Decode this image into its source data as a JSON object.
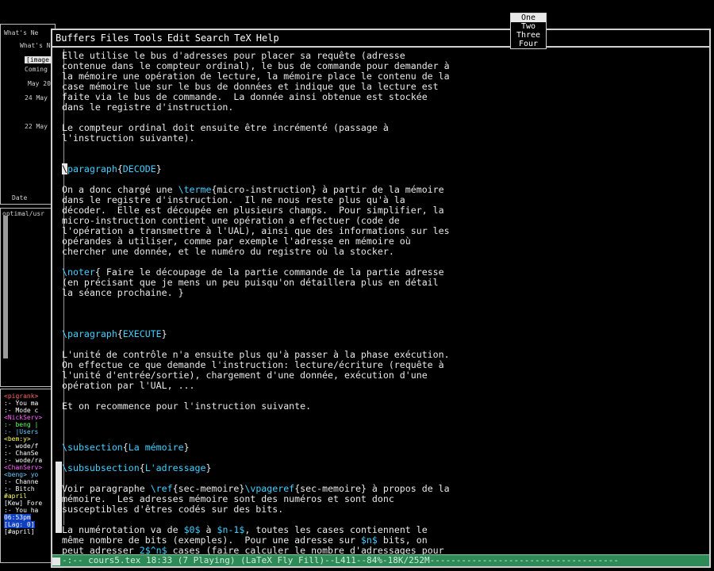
{
  "menubar": {
    "items": [
      "Buffers",
      "Files",
      "Tools",
      "Edit",
      "Search",
      "TeX",
      "Help"
    ]
  },
  "popup": {
    "items": [
      "One",
      "Two",
      "Three",
      "Four"
    ],
    "active_index": 0
  },
  "left_top": {
    "lines": [
      "What's Ne",
      "What's N",
      "[image",
      "Coming",
      "May 20",
      "24 May",
      "22 May",
      "Date"
    ]
  },
  "left_mid": {
    "lines": [
      "optimal/usr"
    ]
  },
  "left_bot": {
    "lines": [
      "<pigrank>",
      ":- You ma",
      ":- Mode c",
      "<NickServ>",
      ":- beng |",
      ":- |Users",
      "<bem:y>",
      ":- wode/f",
      ":- ChanSe",
      ":- wode/ra",
      "<ChanServ>",
      "<beng> yo",
      ":- Channe",
      ":- Bitch",
      "#april",
      "[Kew] Fore",
      ":- You ha",
      "06:53pm",
      "[Lag: 0]",
      "[#april]"
    ],
    "colors": [
      "#ff6666",
      "#ffffff",
      "#ffffff",
      "#ff66ff",
      "#66ff66",
      "#66ccff",
      "#ffff66",
      "#ffffff",
      "#ffffff",
      "#ffffff",
      "#ff66ff",
      "#66ccff",
      "#ffffff",
      "#ffffff",
      "#ffff66",
      "#ffffff",
      "#ffffff",
      "#66ccff",
      "#66ccff",
      "#ffffff"
    ]
  },
  "editor": {
    "lines": [
      [
        {
          "t": "Elle utilise le bus d'adresses pour placer sa requête (adresse"
        }
      ],
      [
        {
          "t": "contenue dans le compteur ordinal), le bus de commande pour demander à"
        }
      ],
      [
        {
          "t": "la mémoire une opération de lecture, la mémoire place le contenu de la"
        }
      ],
      [
        {
          "t": "case mémoire lue sur le bus de données et indique que la lecture est"
        }
      ],
      [
        {
          "t": "faite via le bus de commande.  La donnée ainsi obtenue est stockée"
        }
      ],
      [
        {
          "t": "dans le registre d'instruction."
        }
      ],
      [
        {
          "t": ""
        }
      ],
      [
        {
          "t": "Le compteur ordinal doit ensuite être incrémenté (passage à"
        }
      ],
      [
        {
          "t": "l'instruction suivante)."
        }
      ],
      [
        {
          "t": ""
        }
      ],
      [
        {
          "t": ""
        }
      ],
      [
        {
          "t": "\\",
          "c": "cursor"
        },
        {
          "t": "paragraph",
          "c": "kw"
        },
        {
          "t": "{"
        },
        {
          "t": "DECODE",
          "c": "kw"
        },
        {
          "t": "}"
        }
      ],
      [
        {
          "t": ""
        }
      ],
      [
        {
          "t": "On a donc chargé une "
        },
        {
          "t": "\\terme",
          "c": "kw"
        },
        {
          "t": "{micro-instruction} à partir de la mémoire"
        }
      ],
      [
        {
          "t": "dans le registre d'instruction.  Il ne nous reste plus qu'à la"
        }
      ],
      [
        {
          "t": "décoder.  Elle est découpée en plusieurs champs.  Pour simplifier, la"
        }
      ],
      [
        {
          "t": "micro-instruction contient une opération a effectuer (code de"
        }
      ],
      [
        {
          "t": "l'opération a transmettre à l'UAL), ainsi que des informations sur les"
        }
      ],
      [
        {
          "t": "opérandes à utiliser, comme par exemple l'adresse en mémoire où"
        }
      ],
      [
        {
          "t": "chercher une donnée, et le numéro du registre où la stocker."
        }
      ],
      [
        {
          "t": ""
        }
      ],
      [
        {
          "t": "\\noter",
          "c": "kw"
        },
        {
          "t": "{ Faire le découpage de la partie commande de la partie adresse"
        }
      ],
      [
        {
          "t": "(en précisant que je mens un peu puisqu'on détaillera plus en détail"
        }
      ],
      [
        {
          "t": "la séance prochaine. }"
        }
      ],
      [
        {
          "t": ""
        }
      ],
      [
        {
          "t": ""
        }
      ],
      [
        {
          "t": ""
        }
      ],
      [
        {
          "t": "\\paragraph",
          "c": "kw"
        },
        {
          "t": "{"
        },
        {
          "t": "EXECUTE",
          "c": "kw"
        },
        {
          "t": "}"
        }
      ],
      [
        {
          "t": ""
        }
      ],
      [
        {
          "t": "L'unité de contrôle n'a ensuite plus qu'à passer à la phase exécution."
        }
      ],
      [
        {
          "t": "On effectue ce que demande l'instruction: lecture/écriture (requête à"
        }
      ],
      [
        {
          "t": "l'unité d'entrée/sortie), chargement d'une donnée, exécution d'une"
        }
      ],
      [
        {
          "t": "opération par l'UAL, ..."
        }
      ],
      [
        {
          "t": ""
        }
      ],
      [
        {
          "t": "Et on recommence pour l'instruction suivante."
        }
      ],
      [
        {
          "t": ""
        }
      ],
      [
        {
          "t": ""
        }
      ],
      [
        {
          "t": ""
        }
      ],
      [
        {
          "t": "\\subsection",
          "c": "kw"
        },
        {
          "t": "{"
        },
        {
          "t": "La mémoire",
          "c": "kw"
        },
        {
          "t": "}"
        }
      ],
      [
        {
          "t": ""
        }
      ],
      [
        {
          "t": "\\subsubsection",
          "c": "kw"
        },
        {
          "t": "{"
        },
        {
          "t": "L'adressage",
          "c": "kw"
        },
        {
          "t": "}"
        }
      ],
      [
        {
          "t": ""
        }
      ],
      [
        {
          "t": "Voir paragraphe "
        },
        {
          "t": "\\ref",
          "c": "kw"
        },
        {
          "t": "{sec-memoire}"
        },
        {
          "t": "\\vpageref",
          "c": "kw"
        },
        {
          "t": "{sec-memoire} à propos de la"
        }
      ],
      [
        {
          "t": "mémoire.  Les adresses mémoire sont des numéros et sont donc"
        }
      ],
      [
        {
          "t": "susceptibles d'êtres codés sur des bits."
        }
      ],
      [
        {
          "t": ""
        }
      ],
      [
        {
          "t": "La numérotation va de "
        },
        {
          "t": "$0$",
          "c": "kw"
        },
        {
          "t": " à "
        },
        {
          "t": "$n-1$",
          "c": "kw"
        },
        {
          "t": ", toutes les cases contiennent le"
        }
      ],
      [
        {
          "t": "même nombre de bits (exemples).  Pour une adresse sur "
        },
        {
          "t": "$n$",
          "c": "kw"
        },
        {
          "t": " bits, on"
        }
      ],
      [
        {
          "t": "peut adresser "
        },
        {
          "t": "2$^n$",
          "c": "kw"
        },
        {
          "t": " cases (faire calculer le nombre d'adressages pour"
        }
      ]
    ]
  },
  "modeline": {
    "text": "-:--  cours5.tex      18:33 (7 Playing)    (LaTeX Fly Fill)--L411--84%-18K/252M------------------------------------"
  }
}
